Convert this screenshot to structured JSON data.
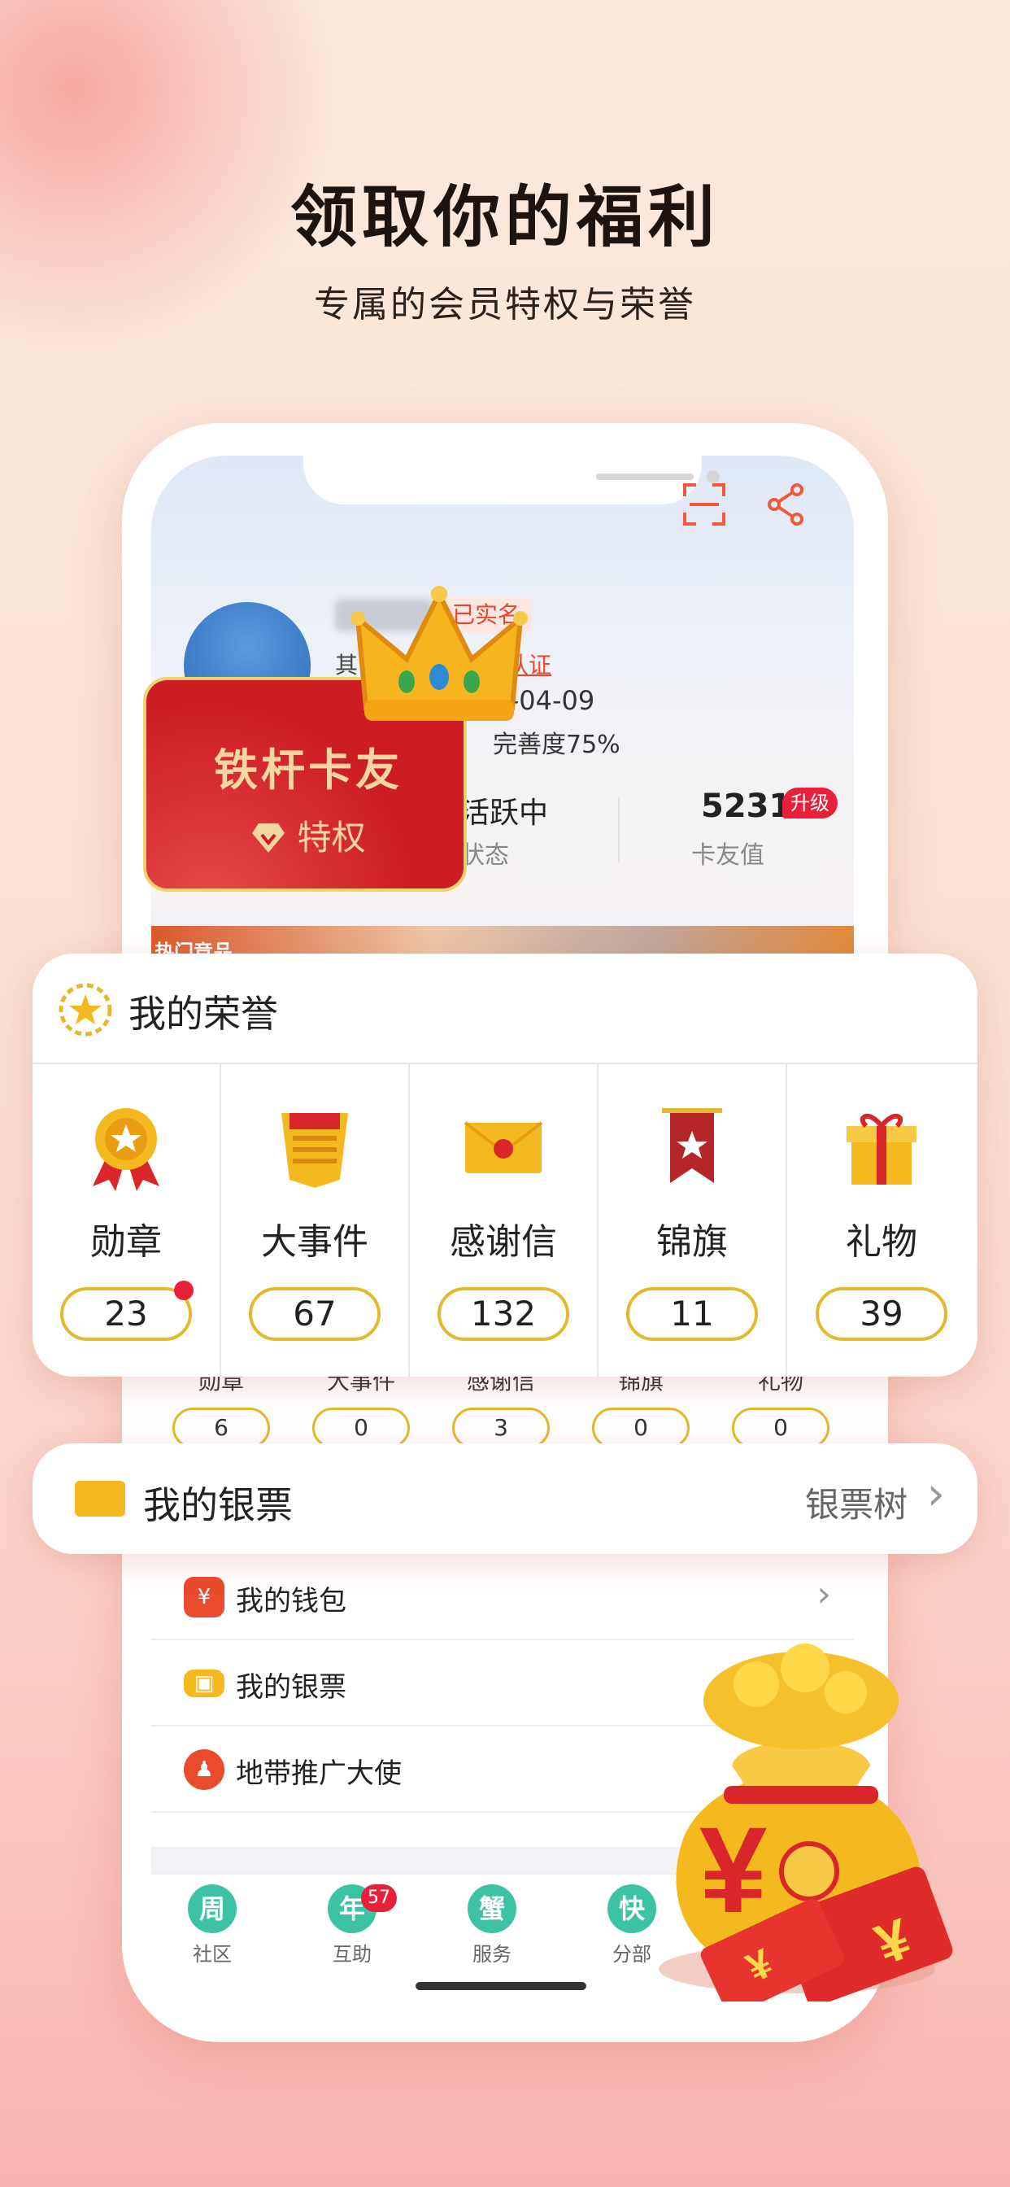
{
  "headline": {
    "title": "领取你的福利",
    "subtitle": "专属的会员特权与荣誉"
  },
  "profile": {
    "verified": "已实名",
    "other_prefix": "其它",
    "complete_auth": "完成认证",
    "date": "21-04-09",
    "completeness": "完善度75%",
    "active_label": "活跃中",
    "status_label": "状态",
    "points": "5231",
    "upgrade": "升级",
    "points_label": "卡友值",
    "banner_tag": "热门竞品"
  },
  "privilege_card": {
    "title": "铁杆卡友",
    "subtitle": "特权"
  },
  "honors": {
    "title": "我的荣誉",
    "items": [
      {
        "label": "勋章",
        "count": "23",
        "dot": true
      },
      {
        "label": "大事件",
        "count": "67"
      },
      {
        "label": "感谢信",
        "count": "132"
      },
      {
        "label": "锦旗",
        "count": "11"
      },
      {
        "label": "礼物",
        "count": "39"
      }
    ]
  },
  "honors_background": {
    "items": [
      {
        "label": "勋章",
        "count": "6"
      },
      {
        "label": "大事件",
        "count": "0"
      },
      {
        "label": "感谢信",
        "count": "3"
      },
      {
        "label": "锦旗",
        "count": "0"
      },
      {
        "label": "礼物",
        "count": "0"
      }
    ]
  },
  "ticket_panel": {
    "title": "我的银票",
    "right_label": "银票树"
  },
  "menu": {
    "items": [
      {
        "label": "我的钱包",
        "icon": "wallet-icon"
      },
      {
        "label": "我的银票",
        "icon": "ticket-icon"
      },
      {
        "label": "地带推广大使",
        "icon": "ambassador-icon"
      }
    ]
  },
  "tabbar": {
    "items": [
      {
        "label": "社区",
        "glyph": "周"
      },
      {
        "label": "互助",
        "glyph": "年",
        "badge": "57"
      },
      {
        "label": "服务",
        "glyph": "蟹"
      },
      {
        "label": "分部",
        "glyph": "快"
      }
    ]
  },
  "colors": {
    "accent": "#e8203a",
    "gold": "#e3b92e",
    "card_red": "#cc1d24"
  }
}
